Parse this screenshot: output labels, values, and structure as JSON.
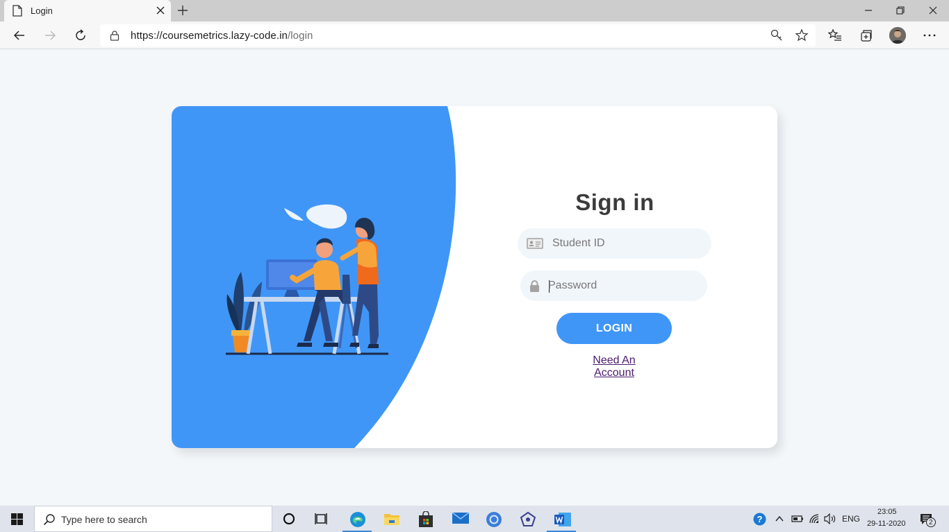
{
  "browser": {
    "tab_title": "Login",
    "url_base": "https://coursemetrics.lazy-code.in",
    "url_path": "/login"
  },
  "login": {
    "title": "Sign in",
    "student_id_placeholder": "Student ID",
    "password_placeholder": "Password",
    "login_button": "LOGIN",
    "need_account_link": "Need An Account"
  },
  "taskbar": {
    "search_placeholder": "Type here to search",
    "language": "ENG",
    "time": "23:05",
    "date": "29-11-2020",
    "notification_count": "2"
  },
  "colors": {
    "accent_blue": "#4096f7",
    "page_background": "#f3f7fa",
    "title_text": "#3b3b3b"
  },
  "icons": [
    "page-icon",
    "close-icon",
    "plus-icon",
    "minimize-icon",
    "restore-icon",
    "back-icon",
    "forward-icon",
    "refresh-icon",
    "lock-icon",
    "key-icon",
    "star-icon",
    "favorites-icon",
    "collections-icon",
    "more-icon",
    "id-card-icon",
    "password-lock-icon",
    "windows-icon",
    "search-icon",
    "cortana-icon",
    "task-view-icon",
    "edge-icon",
    "file-explorer-icon",
    "store-icon",
    "mail-icon",
    "chrome-icon",
    "app-icon",
    "word-icon",
    "help-icon",
    "chevron-up-icon",
    "battery-icon",
    "wifi-icon",
    "volume-icon",
    "notification-icon"
  ]
}
